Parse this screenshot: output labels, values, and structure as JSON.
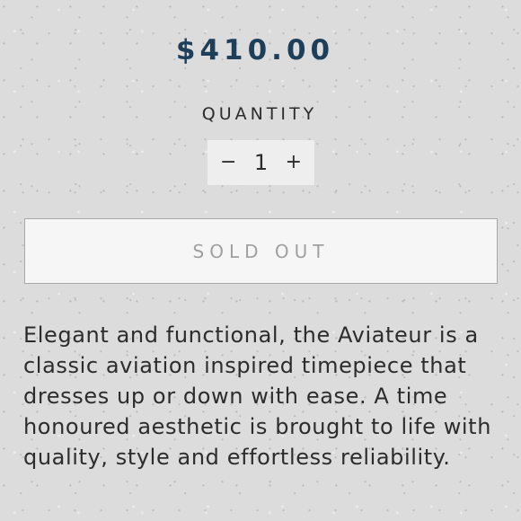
{
  "product": {
    "price": "$410.00",
    "quantity_label": "QUANTITY",
    "quantity_value": "1",
    "decrement_symbol": "−",
    "increment_symbol": "+",
    "sold_out_label": "SOLD OUT",
    "description": "Elegant and functional, the Aviateur is a classic aviation inspired timepiece that dresses up or down with ease. A time honoured aesthetic is brought to life with quality, style and effortless reliability."
  },
  "colors": {
    "price": "#1e3f5a",
    "background": "#dcdcdc",
    "button_text": "#a0a0a0"
  }
}
